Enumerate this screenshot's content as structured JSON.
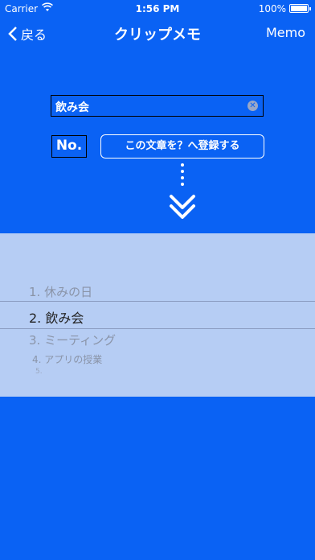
{
  "status_bar": {
    "carrier": "Carrier",
    "time": "1:56 PM",
    "battery": "100%"
  },
  "nav": {
    "back_label": "戻る",
    "title": "クリップメモ",
    "right_label": "Memo"
  },
  "search": {
    "value": "飲み会"
  },
  "number_label": "No.",
  "register_button": "この文章を？へ登録する",
  "picker": {
    "items": [
      "1. 休みの日",
      "2. 飲み会",
      "3. ミーティング",
      "4. アプリの授業",
      "5."
    ],
    "selected": "2. 飲み会"
  },
  "colors": {
    "background": "#0a62f4",
    "picker_bg": "#b6cdf4"
  }
}
